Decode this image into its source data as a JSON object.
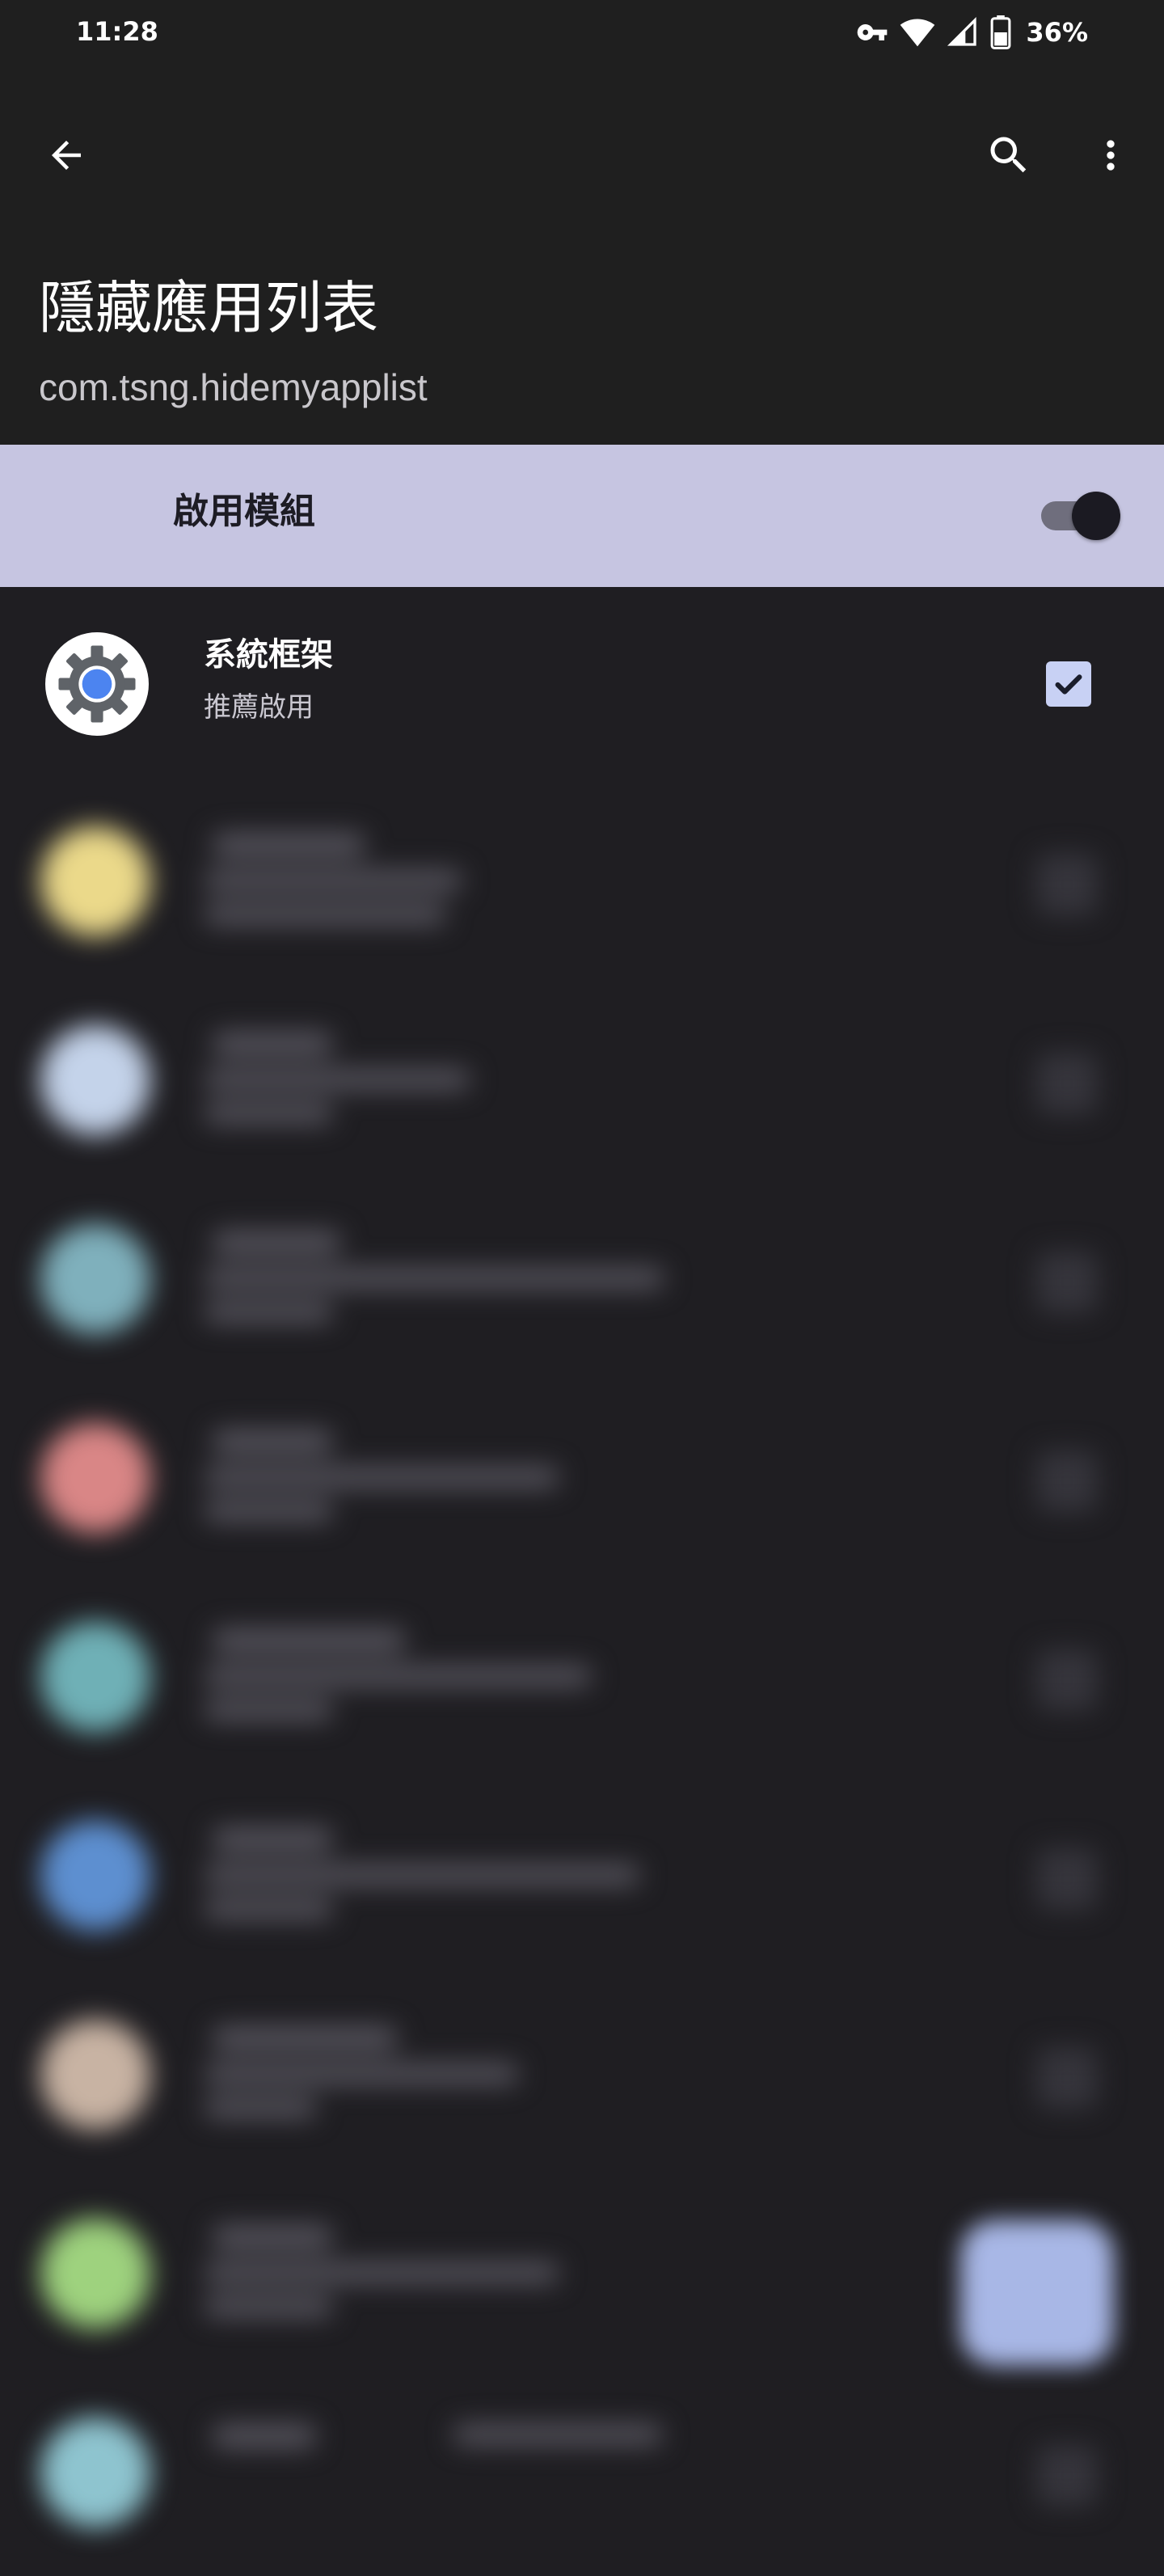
{
  "status_bar": {
    "time": "11:28",
    "battery_percent": "36%",
    "icons": [
      "vpn-key-icon",
      "wifi-icon",
      "cellular-signal-icon",
      "battery-icon"
    ]
  },
  "app_bar": {
    "back_icon": "arrow-back-icon",
    "search_icon": "search-icon",
    "more_icon": "more-vert-icon",
    "title": "隱藏應用列表",
    "package_name": "com.tsng.hidemyapplist"
  },
  "master_switch": {
    "label": "啟用模組",
    "enabled": true
  },
  "scope_list": {
    "items": [
      {
        "name": "系統框架",
        "subtitle": "推薦啟用",
        "icon": "system-framework-gear-icon",
        "checked": true
      }
    ],
    "blurred_items": [
      {
        "icon_color": "#ebd98a"
      },
      {
        "icon_color": "#c4d3ea"
      },
      {
        "icon_color": "#7fb0bc"
      },
      {
        "icon_color": "#d98686"
      },
      {
        "icon_color": "#6fb0b6"
      },
      {
        "icon_color": "#5d8fd0"
      },
      {
        "icon_color": "#c8b3a3"
      },
      {
        "icon_color": "#9ed27e"
      },
      {
        "icon_color": "#8ec4cf"
      }
    ]
  },
  "colors": {
    "background": "#1f1e22",
    "header_background": "#1f1f1f",
    "switch_row_background": "#c6c5e1",
    "checkbox_fill": "#c8d1f4",
    "fab": "#a8b7e6"
  }
}
